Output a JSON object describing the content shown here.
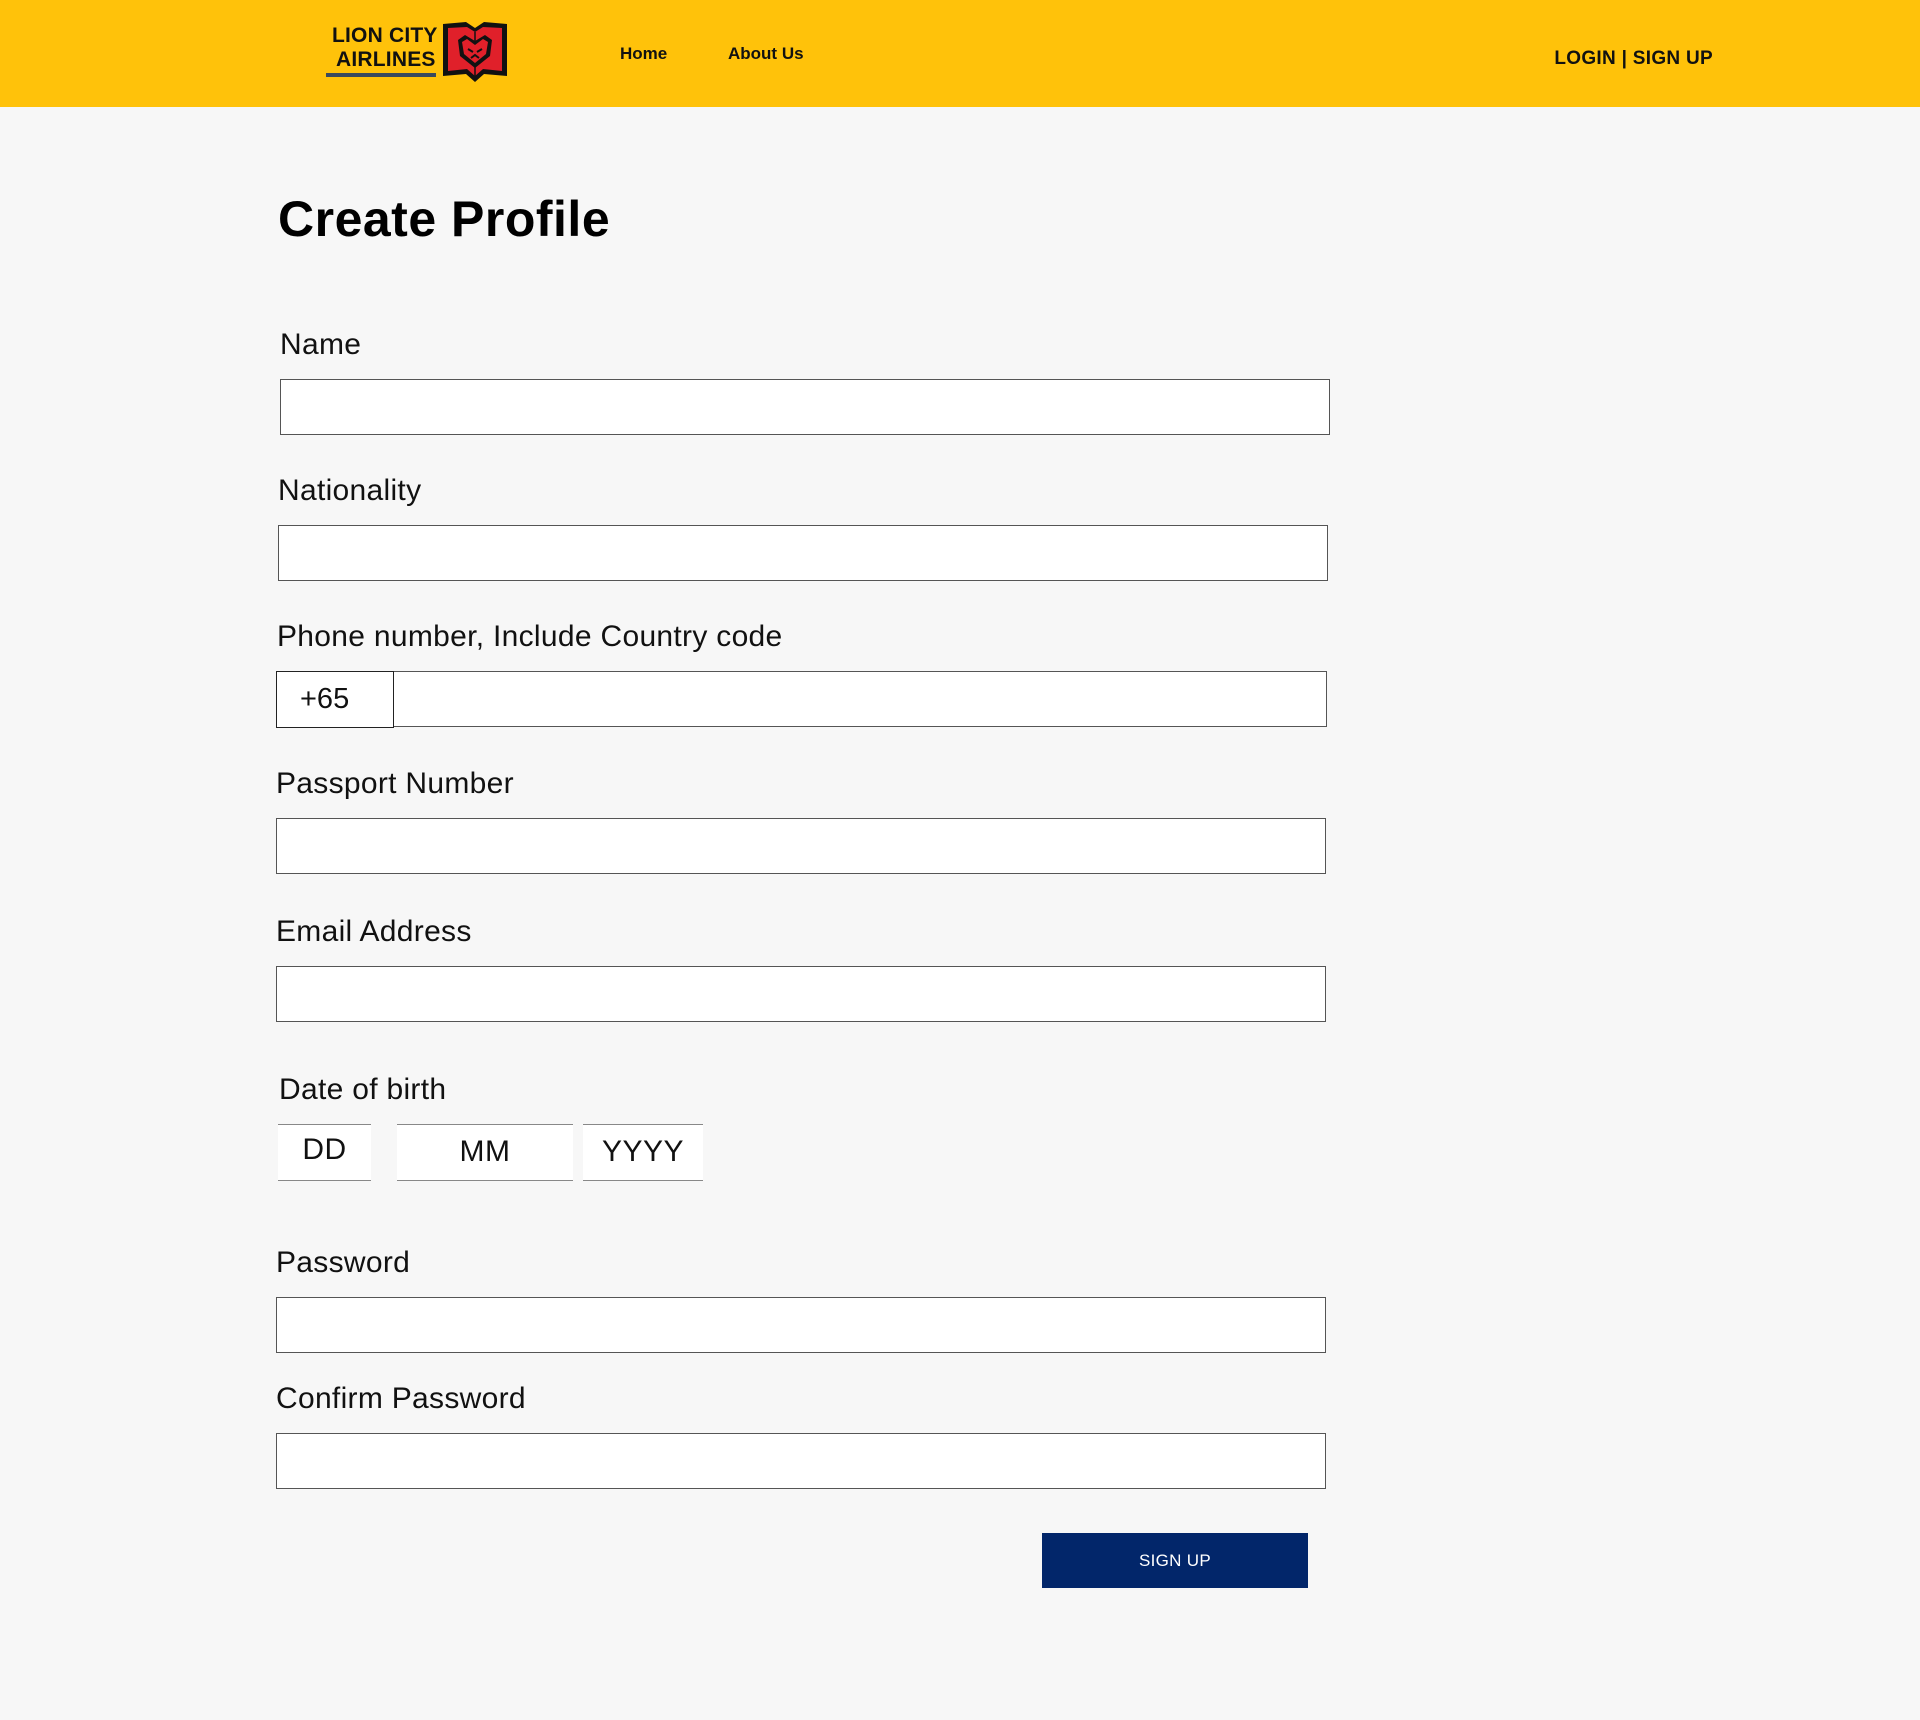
{
  "header": {
    "logo_line1": "LION CITY",
    "logo_line2": "AIRLINES",
    "nav": {
      "home": "Home",
      "about": "About Us"
    },
    "auth": "LOGIN | SIGN UP"
  },
  "colors": {
    "header_bg": "#ffc20a",
    "page_bg": "#f7f7f7",
    "button_bg": "#02266a",
    "logo_red": "#e0202a"
  },
  "form": {
    "title": "Create Profile",
    "name": {
      "label": "Name",
      "value": ""
    },
    "nationality": {
      "label": "Nationality",
      "value": ""
    },
    "phone": {
      "label": "Phone number, Include Country code",
      "prefix": "+65",
      "value": ""
    },
    "passport": {
      "label": "Passport Number",
      "value": ""
    },
    "email": {
      "label": "Email Address",
      "value": ""
    },
    "dob": {
      "label": "Date of birth",
      "day": "DD",
      "month": "MM",
      "year": "YYYY"
    },
    "password": {
      "label": "Password",
      "value": ""
    },
    "confirm_password": {
      "label": "Confirm Password",
      "value": ""
    },
    "submit": "SIGN UP"
  }
}
